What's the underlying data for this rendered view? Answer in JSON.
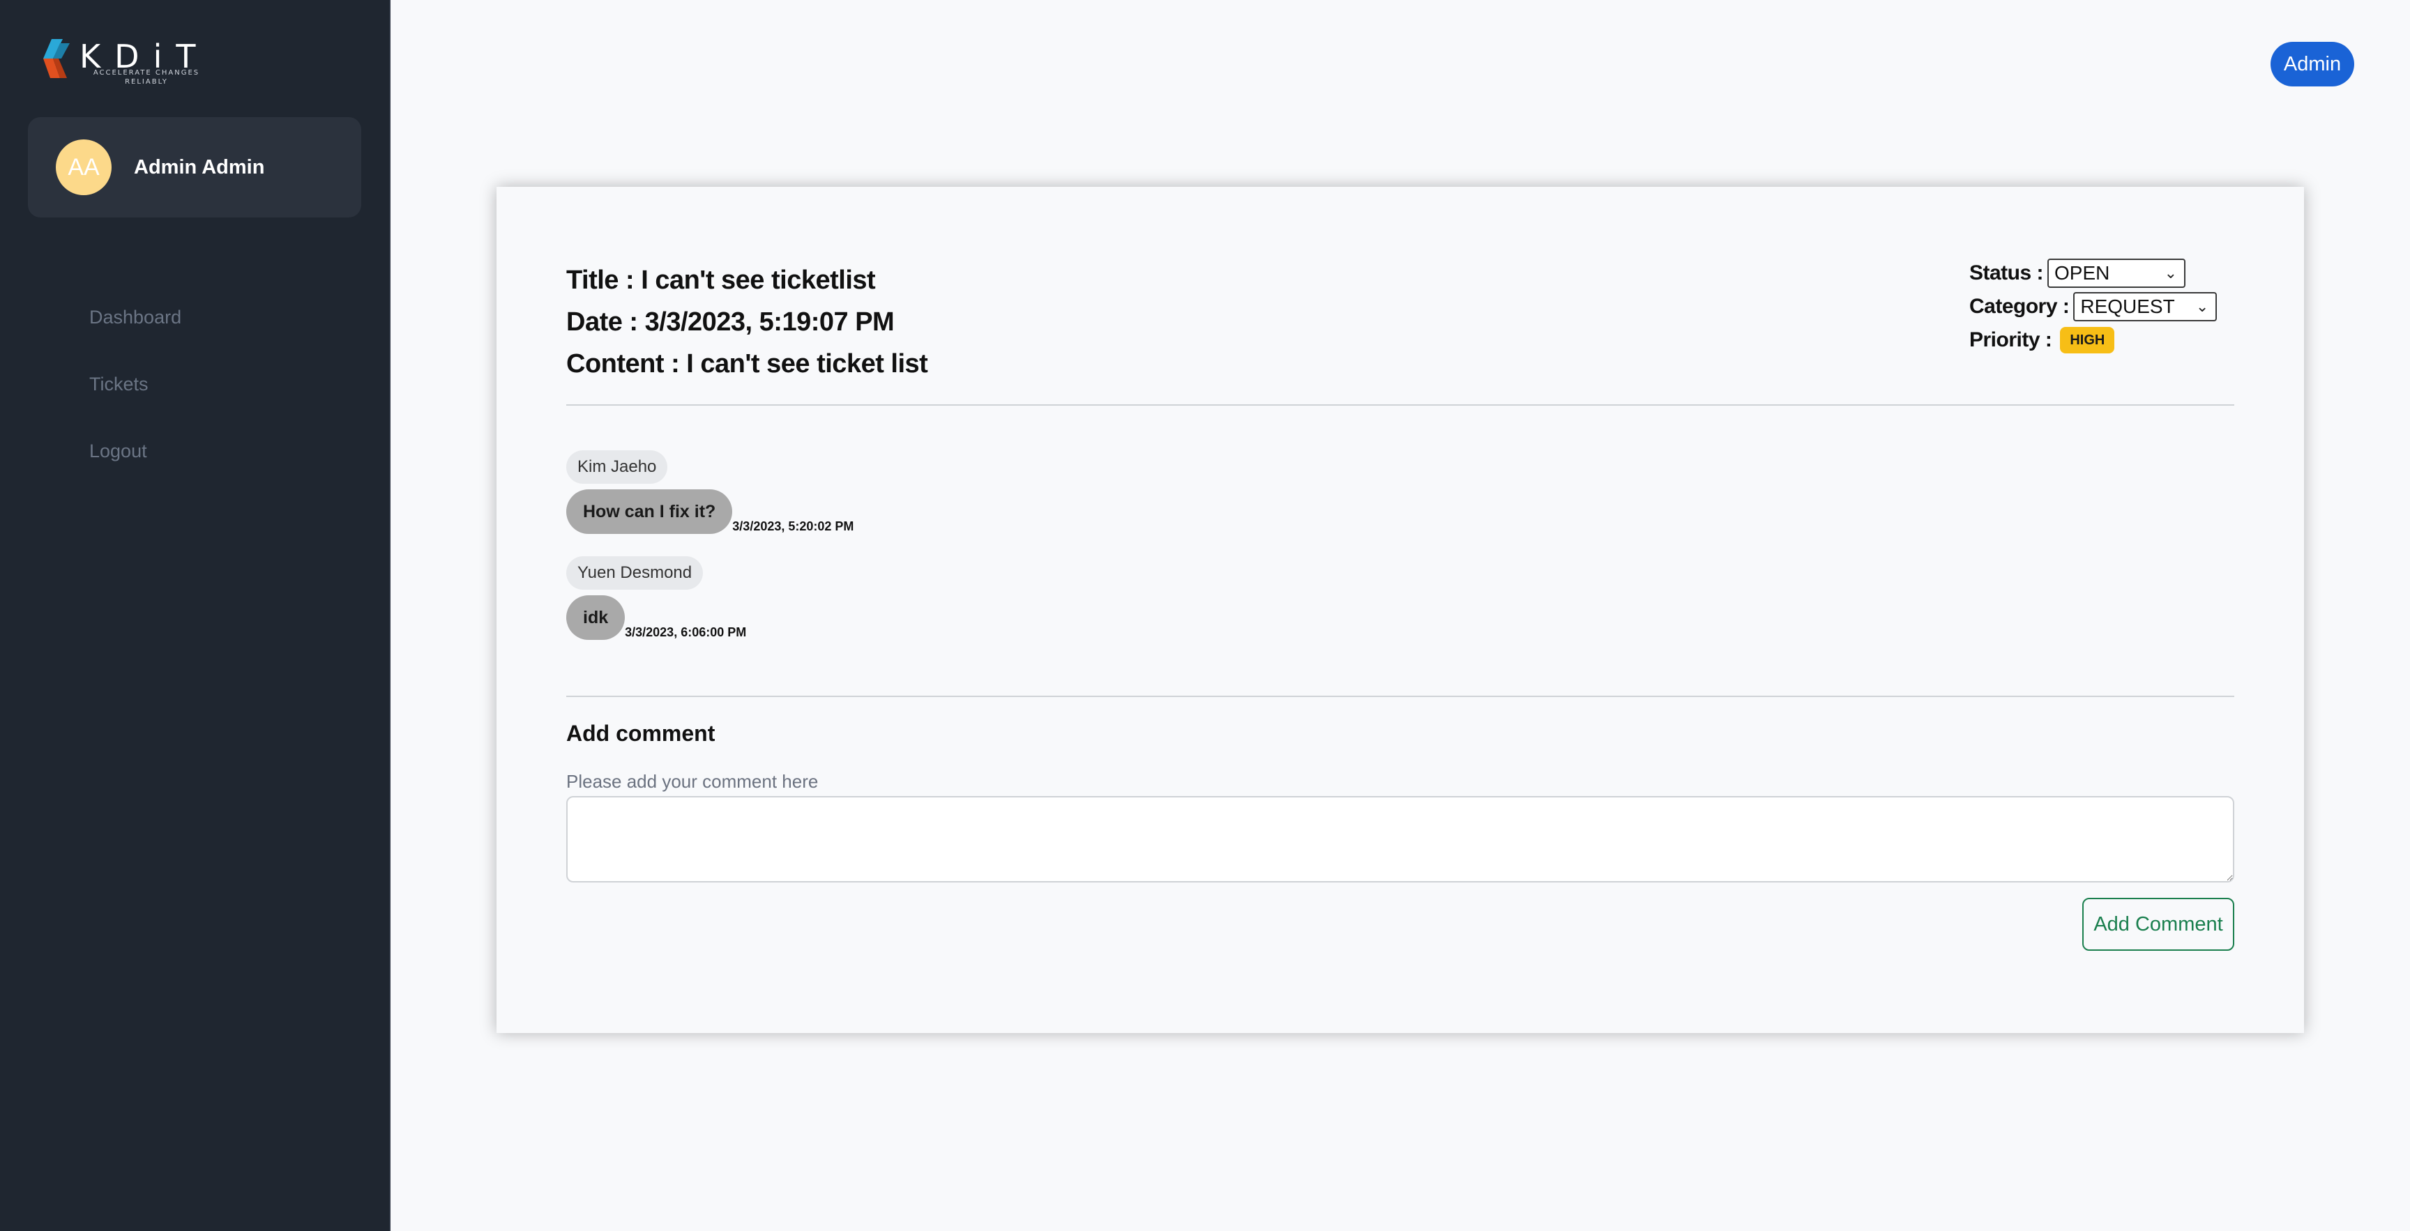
{
  "sidebar": {
    "logo": {
      "word": "KDiT",
      "tagline": "ACCELERATE CHANGES RELIABLY"
    },
    "user": {
      "initials": "AA",
      "name": "Admin Admin"
    },
    "nav": [
      {
        "label": "Dashboard"
      },
      {
        "label": "Tickets"
      },
      {
        "label": "Logout"
      }
    ]
  },
  "header": {
    "role_button": "Admin"
  },
  "ticket": {
    "title_line": "Title : I can't see ticketlist",
    "date_line": "Date : 3/3/2023, 5:19:07 PM",
    "content_line": "Content : I can't see ticket list",
    "status_label": "Status :",
    "status_value": "OPEN",
    "category_label": "Category :",
    "category_value": "REQUEST",
    "priority_label": "Priority :",
    "priority_value": "HIGH"
  },
  "comments": [
    {
      "author": "Kim Jaeho",
      "text": "How can I fix it?",
      "time": "3/3/2023, 5:20:02 PM"
    },
    {
      "author": "Yuen Desmond",
      "text": "idk",
      "time": "3/3/2023, 6:06:00 PM"
    }
  ],
  "add_comment": {
    "title": "Add comment",
    "label": "Please add your comment here",
    "value": "",
    "button": "Add Comment"
  },
  "colors": {
    "sidebar_bg": "#1f2630",
    "accent_blue": "#1a63d6",
    "priority_high": "#f7be16",
    "success_green": "#1a7f4e",
    "avatar_bg": "#fcd98a"
  }
}
